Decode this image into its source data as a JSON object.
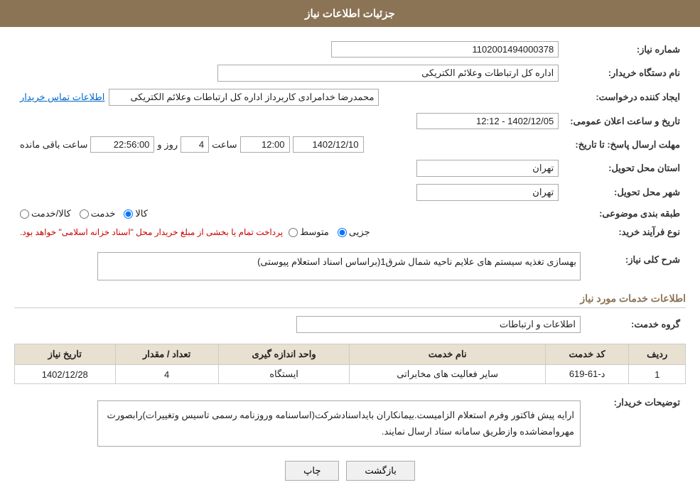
{
  "header": {
    "title": "جزئیات اطلاعات نیاز"
  },
  "fields": {
    "need_number_label": "شماره نیاز:",
    "need_number_value": "1102001494000378",
    "buyer_org_label": "نام دستگاه خریدار:",
    "buyer_org_value": "اداره کل ارتباطات وعلائم الکتریکی",
    "creator_label": "ایجاد کننده درخواست:",
    "creator_name": "محمدرضا خدامرادی کاربرداز اداره کل ارتباطات وعلائم الکتریکی",
    "creator_link": "اطلاعات تماس خریدار",
    "announce_date_label": "تاریخ و ساعت اعلان عمومی:",
    "announce_date_value": "1402/12/05 - 12:12",
    "response_deadline_label": "مهلت ارسال پاسخ: تا تاریخ:",
    "response_date": "1402/12/10",
    "response_time_label": "ساعت",
    "response_time": "12:00",
    "response_days_label": "روز و",
    "response_days": "4",
    "response_remaining_label": "ساعت باقی مانده",
    "response_remaining": "22:56:00",
    "province_label": "استان محل تحویل:",
    "province_value": "تهران",
    "city_label": "شهر محل تحویل:",
    "city_value": "تهران",
    "category_label": "طبقه بندی موضوعی:",
    "category_options": [
      "کالا",
      "خدمت",
      "کالا/خدمت"
    ],
    "category_selected": "کالا",
    "purchase_type_label": "نوع فرآیند خرید:",
    "purchase_options": [
      "جزیی",
      "متوسط"
    ],
    "purchase_note": "پرداخت تمام یا بخشی از مبلغ خریدار محل \"اسناد خزانه اسلامی\" خواهد بود.",
    "need_description_label": "شرح کلی نیاز:",
    "need_description_value": "بهسازی تغذیه سیستم های علایم ناحیه شمال شرق1(براساس اسناد استعلام پیوستی)",
    "services_label": "اطلاعات خدمات مورد نیاز",
    "service_group_label": "گروه خدمت:",
    "service_group_value": "اطلاعات و ارتباطات"
  },
  "table": {
    "headers": [
      "ردیف",
      "کد خدمت",
      "نام خدمت",
      "واحد اندازه گیری",
      "تعداد / مقدار",
      "تاریخ نیاز"
    ],
    "rows": [
      {
        "row": "1",
        "service_code": "د-61-619",
        "service_name": "سایر فعالیت های مخابراتی",
        "unit": "ایستگاه",
        "quantity": "4",
        "date": "1402/12/28"
      }
    ]
  },
  "buyer_notes_label": "توضیحات خریدار:",
  "buyer_notes_value": "ارایه پیش فاکتور وفرم استعلام الزامیست.بیمانکاران بایداسنادشرکت(اساسنامه وروزنامه رسمی تاسیس وتغییرات)رابصورت مهروامضاشده وازطریق سامانه ستاد ارسال نمایند.",
  "buttons": {
    "print": "چاپ",
    "back": "بازگشت"
  }
}
